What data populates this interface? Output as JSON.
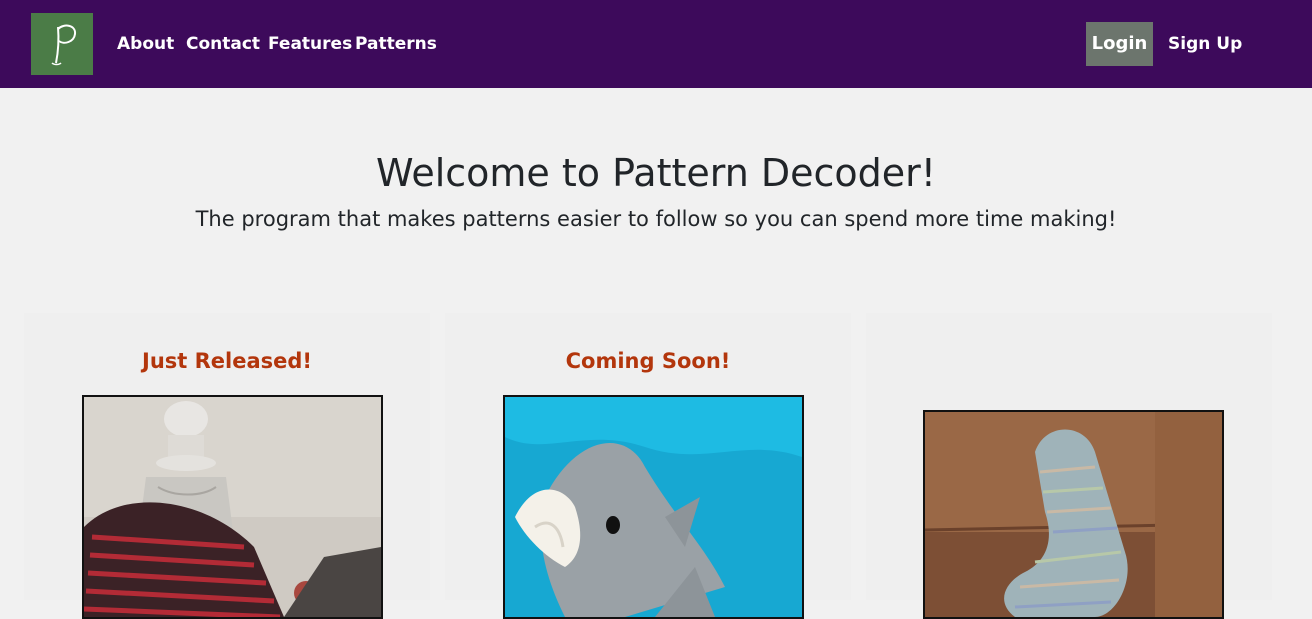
{
  "navbar": {
    "logo_letter": "P",
    "links": [
      {
        "label": "About"
      },
      {
        "label": "Contact"
      },
      {
        "label": "Features"
      },
      {
        "label": "Patterns"
      }
    ],
    "login_label": "Login",
    "signup_label": "Sign Up",
    "colors": {
      "background": "#3d0a5b",
      "logo": "#4b7c47",
      "login_button": "#6c756d"
    }
  },
  "hero": {
    "title": "Welcome to Pattern Decoder!",
    "subtitle": "The program that makes patterns easier to follow so you can spend more time making!"
  },
  "cards": [
    {
      "heading": "Just Released!",
      "image": "knitted-cowl-photo"
    },
    {
      "heading": "Coming Soon!",
      "image": "knitted-shark-photo"
    },
    {
      "heading": "",
      "image": "knitted-sock-photo"
    }
  ],
  "accent_color": "#b3360c"
}
